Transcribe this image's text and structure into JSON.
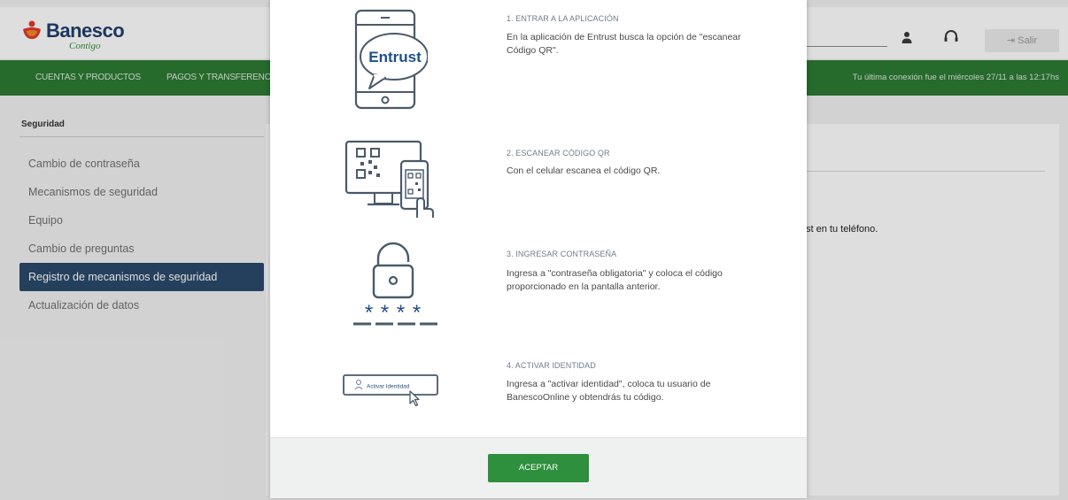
{
  "header": {
    "logo_text": "Banesco",
    "logo_sub": "Contigo",
    "logout_label": "Salir"
  },
  "nav": {
    "items": [
      "CUENTAS Y PRODUCTOS",
      "PAGOS Y TRANSFERENCIAS"
    ],
    "last_connection": "Tu última conexión fue el miércoles 27/11 a las 12:17hs"
  },
  "sidebar": {
    "title": "Seguridad",
    "items": [
      "Cambio de contraseña",
      "Mecanismos de seguridad",
      "Equipo",
      "Cambio de preguntas",
      "Registro de mecanismos de seguridad",
      "Actualización de datos"
    ],
    "active_index": 4
  },
  "content": {
    "visible_text": "st en tu teléfono."
  },
  "modal": {
    "steps": [
      {
        "title": "1. ENTRAR A LA APLICACIÓN",
        "description": "En la aplicación de Entrust busca la opción de \"escanear Código QR\".",
        "icon": "phone-entrust-icon",
        "icon_label": "Entrust"
      },
      {
        "title": "2. ESCANEAR CÓDIGO QR",
        "description": "Con el celular escanea el código QR.",
        "icon": "qr-scan-icon"
      },
      {
        "title": "3. INGRESAR CONTRASEÑA",
        "description": "Ingresa a \"contraseña obligatoria\" y coloca el código proporcionado en la pantalla anterior.",
        "icon": "lock-password-icon",
        "icon_label": "* * * *"
      },
      {
        "title": "4. ACTIVAR IDENTIDAD",
        "description": "Ingresa a \"activar identidad\", coloca tu usuario de BanescoOnline y obtendrás tu código.",
        "icon": "activate-identity-icon",
        "icon_label": "Activar Identidad"
      }
    ],
    "accept_label": "ACEPTAR"
  },
  "colors": {
    "brand_green": "#2c7a33",
    "brand_navy": "#1f3f6e",
    "active_item": "#2b4a6b",
    "accept_button": "#2e8f3c",
    "logo_red": "#e03a2f"
  }
}
